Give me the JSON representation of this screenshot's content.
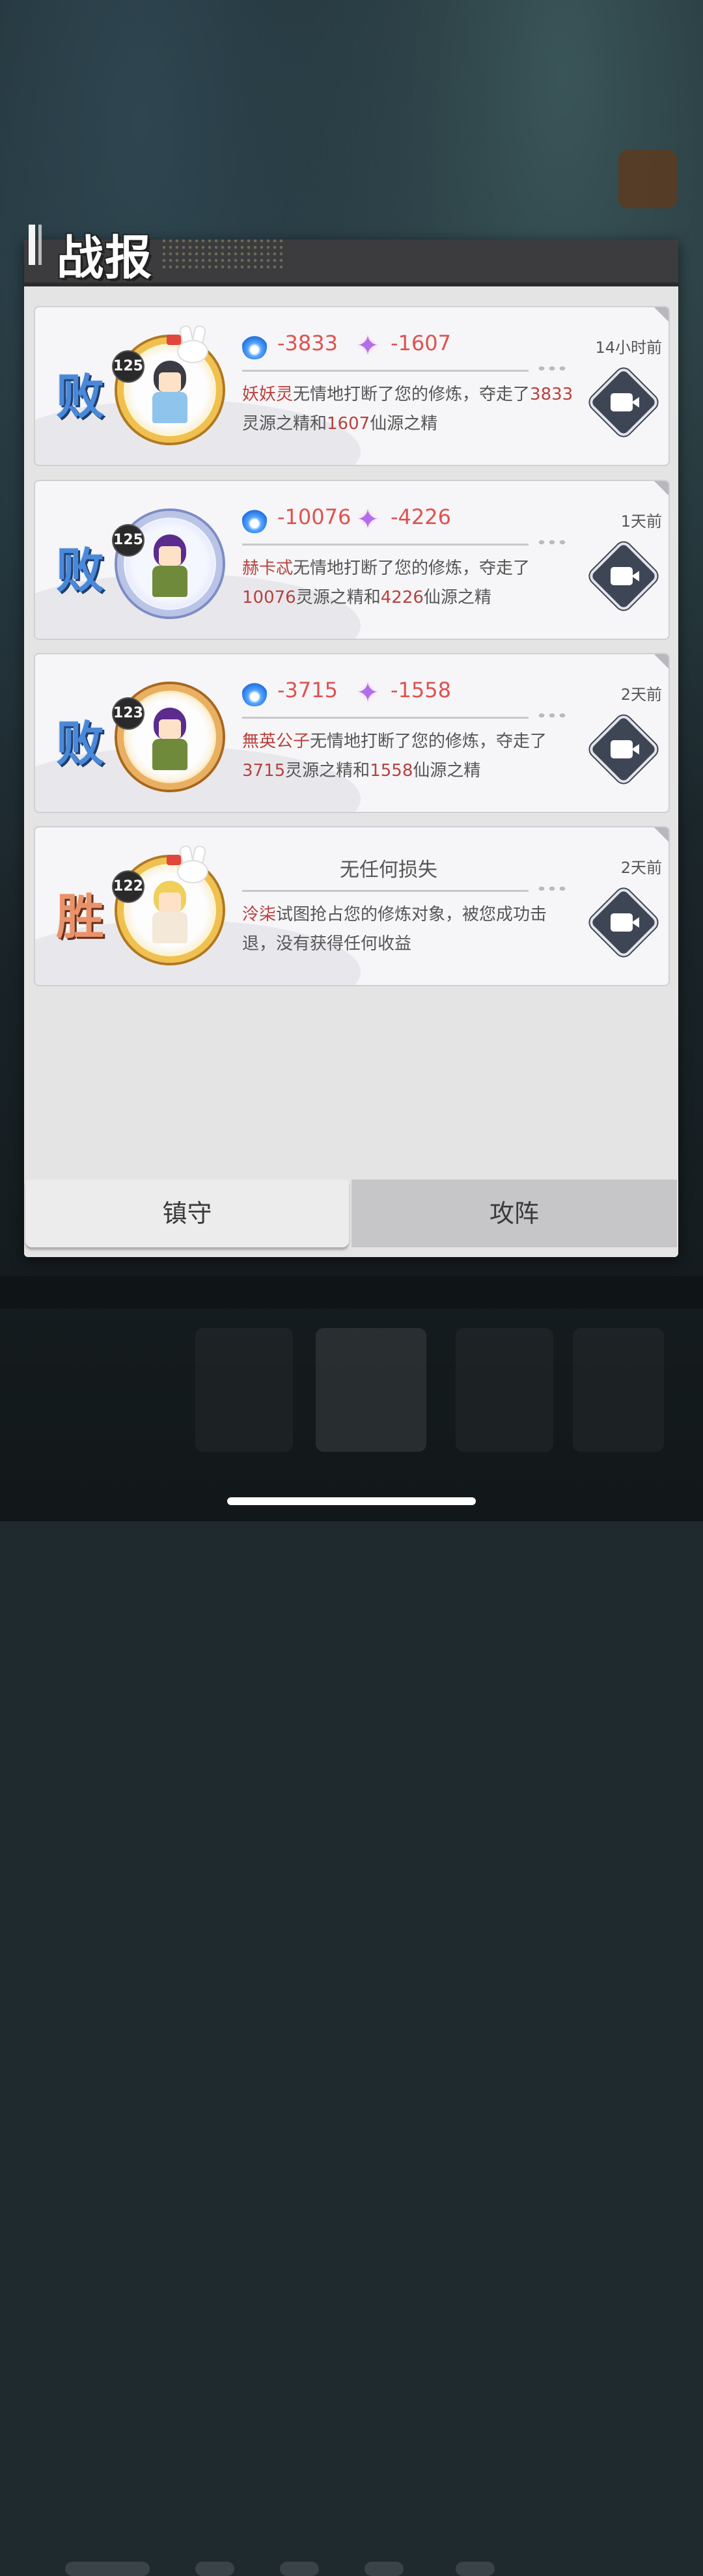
{
  "panel": {
    "title": "战报"
  },
  "reports": [
    {
      "result": "败",
      "level": "125",
      "spirit_loss": "-3833",
      "immortal_loss": "-1607",
      "time": "14小时前",
      "attacker": "妖妖灵",
      "text_a": "无情地打断了您的修炼，夺走了",
      "num1": "3833",
      "text_b": "灵源之精和",
      "num2": "1607",
      "text_c": "仙源之精"
    },
    {
      "result": "败",
      "level": "125",
      "spirit_loss": "-10076",
      "immortal_loss": "-4226",
      "time": "1天前",
      "attacker": "赫卡忒",
      "text_a": "无情地打断了您的修炼，夺走了",
      "num1": "10076",
      "text_b": "灵源之精和",
      "num2": "4226",
      "text_c": "仙源之精"
    },
    {
      "result": "败",
      "level": "123",
      "spirit_loss": "-3715",
      "immortal_loss": "-1558",
      "time": "2天前",
      "attacker": "無英公子",
      "text_a": "无情地打断了您的修炼，夺走了",
      "num1": "3715",
      "text_b": "灵源之精和",
      "num2": "1558",
      "text_c": "仙源之精"
    },
    {
      "result": "胜",
      "level": "122",
      "summary": "无任何损失",
      "time": "2天前",
      "attacker": "泠柒",
      "text_a": "试图抢占您的修炼对象，被您成功击退，没有获得任何收益"
    }
  ],
  "tabs": {
    "defend": "镇守",
    "attack": "攻阵"
  },
  "icons": {
    "spirit": "blue-flame-icon",
    "immortal": "purple-star-icon",
    "replay": "video-replay-icon"
  },
  "colors": {
    "lose": "#4a88d8",
    "win": "#e8936b",
    "loss_value": "#e0514f",
    "name_highlight": "#b8413d"
  }
}
